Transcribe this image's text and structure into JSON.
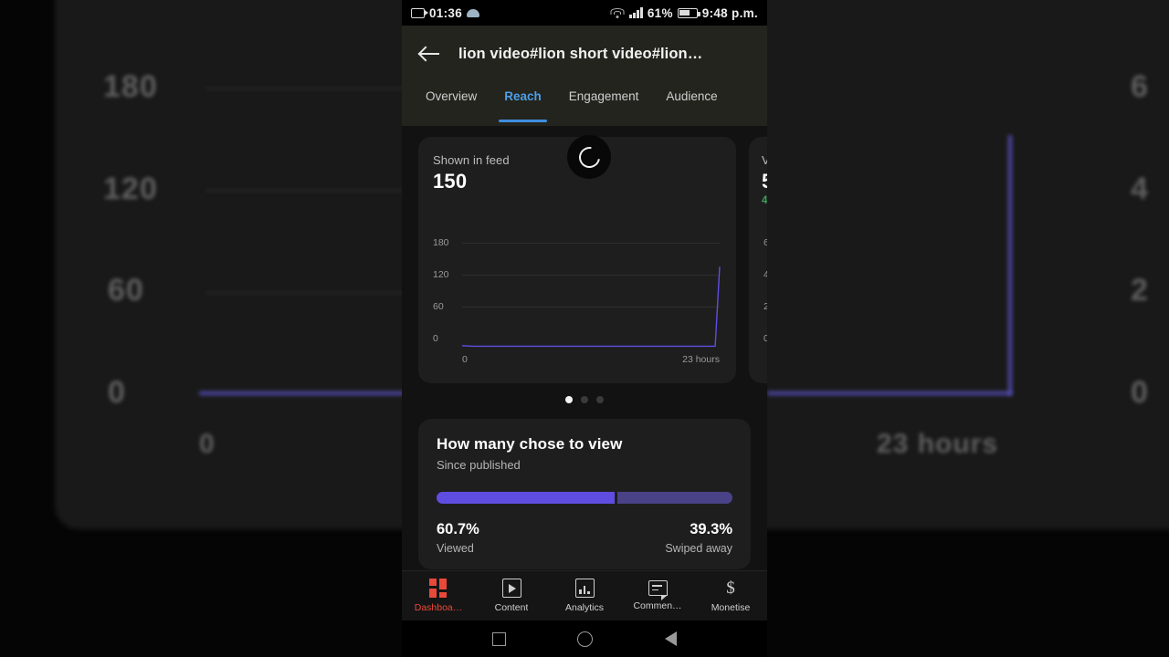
{
  "statusbar": {
    "time_left": "01:36",
    "battery_percent": "61%",
    "clock": "9:48 p.m.",
    "icons": [
      "video-recording-icon",
      "cloud-icon",
      "wifi-icon",
      "signal-bars-icon",
      "battery-icon"
    ]
  },
  "header": {
    "back_icon": "back-arrow-icon",
    "title": "lion video#lion short video#lion…"
  },
  "tabs": [
    {
      "label": "Overview",
      "active": false
    },
    {
      "label": "Reach",
      "active": true
    },
    {
      "label": "Engagement",
      "active": false
    },
    {
      "label": "Audience",
      "active": false
    }
  ],
  "carousel": {
    "spinner": "loading-spinner-icon",
    "dots": [
      true,
      false,
      false
    ],
    "cards": [
      {
        "label": "Shown in feed",
        "value": "150",
        "delta": ""
      },
      {
        "label": "V",
        "value": "5",
        "delta": "4"
      }
    ]
  },
  "view_card": {
    "title": "How many chose to view",
    "subtitle": "Since published",
    "left_percent": "60.7%",
    "right_percent": "39.3%",
    "left_label": "Viewed",
    "right_label": "Swiped away",
    "left_fraction": 60.7,
    "right_fraction": 39.3,
    "left_color": "#5f4de2",
    "right_color": "#494287"
  },
  "bottom_nav": [
    {
      "label": "Dashboa…",
      "icon": "dashboard-grid-icon",
      "active": true
    },
    {
      "label": "Content",
      "icon": "content-play-icon",
      "active": false
    },
    {
      "label": "Analytics",
      "icon": "analytics-bar-icon",
      "active": false
    },
    {
      "label": "Commen…",
      "icon": "comment-bubble-icon",
      "active": false
    },
    {
      "label": "Monetise",
      "icon": "dollar-sign-icon",
      "active": false
    }
  ],
  "system_nav": [
    {
      "icon": "recents-square-icon"
    },
    {
      "icon": "home-circle-icon"
    },
    {
      "icon": "back-triangle-icon"
    }
  ],
  "theme": {
    "accent_blue": "#3f8ee0",
    "accent_red": "#e8493a",
    "line_purple": "#5f4de2",
    "card_bg": "#1e1e1e",
    "header_bg": "#23241d"
  },
  "chart_data": {
    "type": "line",
    "title": "Shown in feed",
    "value_label": "150",
    "xlabel": "",
    "ylabel": "",
    "x_tick_labels": [
      "0",
      "23 hours"
    ],
    "y_ticks": [
      0,
      60,
      120,
      180
    ],
    "ylim": [
      0,
      195
    ],
    "xlim": [
      0,
      23
    ],
    "grid": true,
    "legend": "none",
    "series": [
      {
        "name": "Shown in feed",
        "color": "#5f4de2",
        "x": [
          0,
          1,
          2,
          3,
          4,
          5,
          6,
          7,
          8,
          9,
          10,
          11,
          12,
          13,
          14,
          15,
          16,
          17,
          18,
          19,
          20,
          21,
          22,
          22.6,
          23
        ],
        "values": [
          2,
          1,
          1,
          1,
          1,
          1,
          1,
          1,
          1,
          1,
          1,
          1,
          1,
          1,
          1,
          1,
          1,
          1,
          1,
          1,
          1,
          1,
          1,
          1,
          150
        ]
      }
    ],
    "secondary_chart": {
      "type": "line",
      "title": "V",
      "value_label": "5",
      "y_ticks": [
        0,
        2,
        4,
        6
      ],
      "x_tick_labels": [
        "0",
        "23 hours"
      ]
    }
  }
}
